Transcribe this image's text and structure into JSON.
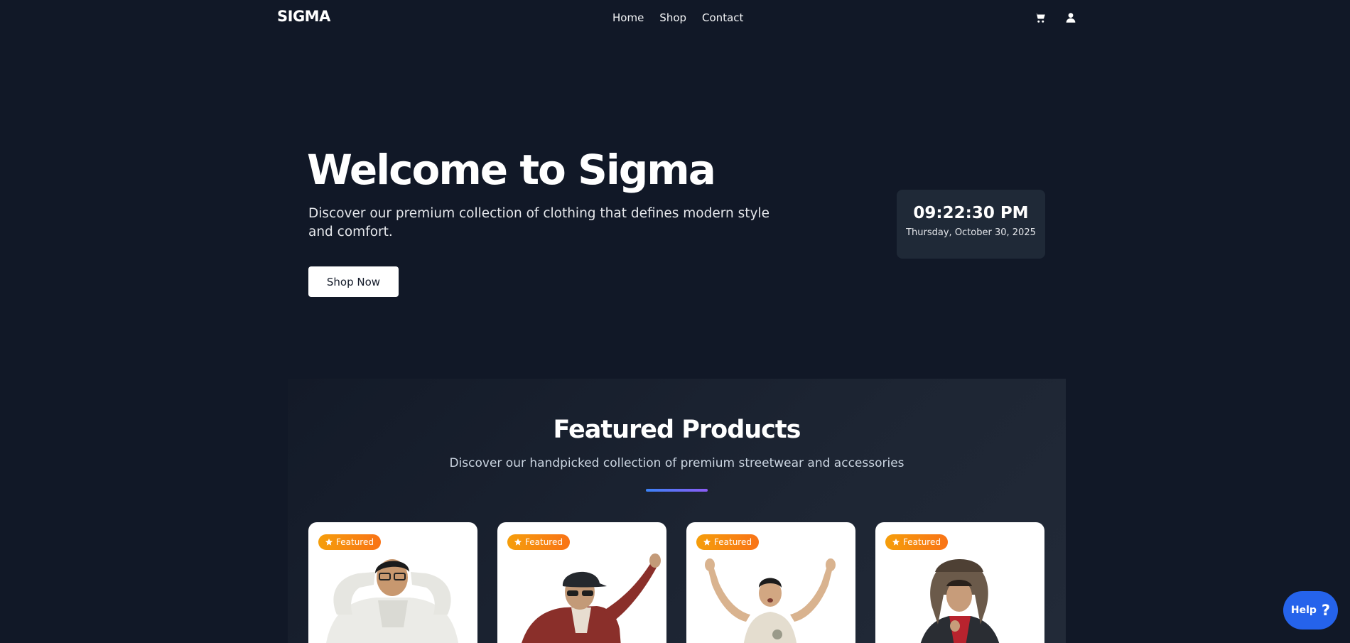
{
  "navbar": {
    "brand": "SIGMA",
    "links": [
      "Home",
      "Shop",
      "Contact"
    ],
    "icons": [
      "cart-icon",
      "user-icon"
    ]
  },
  "hero": {
    "title": "Welcome to Sigma",
    "subtitle": "Discover our premium collection of clothing that defines modern style and comfort.",
    "cta": "Shop Now"
  },
  "clock": {
    "time": "09:22:30 PM",
    "date": "Thursday, October 30, 2025"
  },
  "featured": {
    "title": "Featured Products",
    "subtitle": "Discover our handpicked collection of premium streetwear and accessories",
    "products": [
      {
        "badge": "Featured",
        "badge_icon": "star-icon",
        "image": "model in white hoodie"
      },
      {
        "badge": "Featured",
        "badge_icon": "star-icon",
        "image": "model in red flannel shirt and cap"
      },
      {
        "badge": "Featured",
        "badge_icon": "star-icon",
        "image": "model in beige t-shirt"
      },
      {
        "badge": "Featured",
        "badge_icon": "star-icon",
        "image": "model in fur trapper hat and black blazer"
      }
    ]
  },
  "help": {
    "label": "Help",
    "icon": "?"
  },
  "colors": {
    "background": "#111827",
    "card": "#1f2937",
    "accent": "#2563eb",
    "badge_from": "#f59e0b",
    "badge_to": "#f97316",
    "divider_from": "#3b82f6",
    "divider_to": "#8b5cf6"
  }
}
